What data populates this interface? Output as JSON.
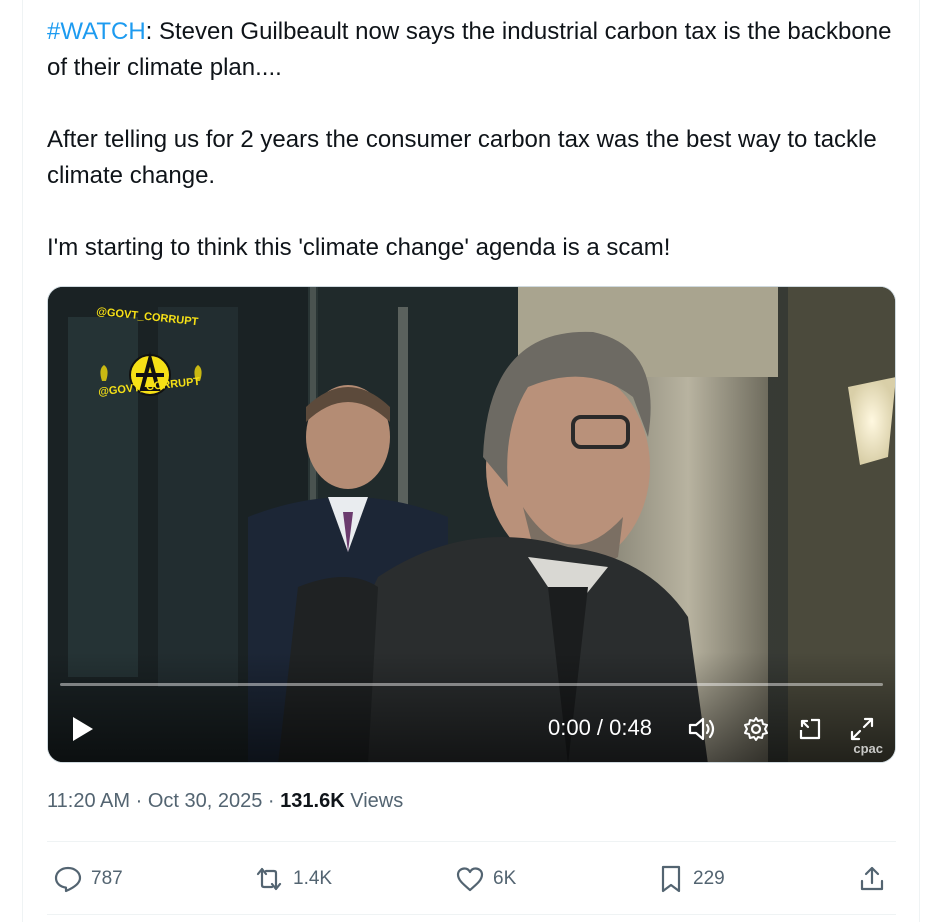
{
  "tweet": {
    "hashtag": "#WATCH",
    "line1_rest": ": Steven Guilbeault now says the industrial carbon tax is the backbone of their climate plan....",
    "paragraph2": "After telling us for 2 years the consumer carbon tax was the best way to tackle climate change.",
    "paragraph3": "I'm starting to think this 'climate change' agenda is a scam!"
  },
  "video": {
    "watermark_top": "@GOVT_CORRUPT",
    "watermark_bottom": "@GOVT_CORRUPT",
    "time_display": "0:00 / 0:48",
    "progress": 0,
    "broadcaster_logo": "cpac",
    "icons": {
      "play": "play-icon",
      "volume": "volume-icon",
      "settings": "gear-icon",
      "pip": "picture-in-picture-icon",
      "fullscreen": "fullscreen-icon"
    }
  },
  "meta": {
    "time": "11:20 AM",
    "separator": "·",
    "date": "Oct 30, 2025",
    "separator2": "·",
    "views_count": "131.6K",
    "views_label": "Views"
  },
  "actions": {
    "replies": "787",
    "reposts": "1.4K",
    "likes": "6K",
    "bookmarks": "229"
  },
  "colors": {
    "link": "#1d9bf0",
    "text": "#0f1419",
    "secondary": "#536471",
    "border": "#eff3f4"
  }
}
